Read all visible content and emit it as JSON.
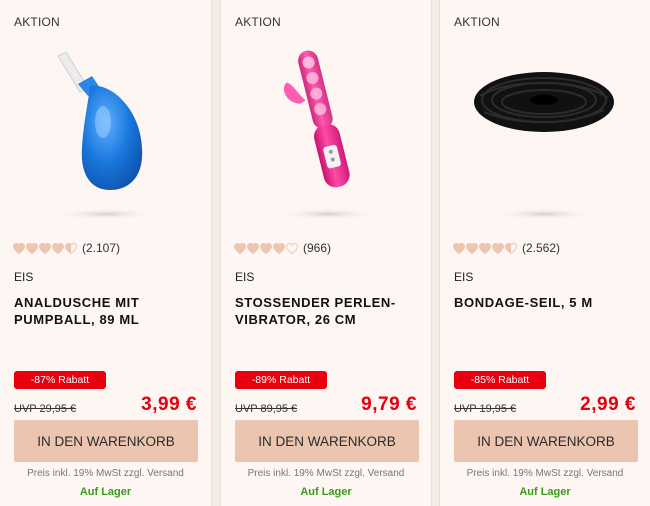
{
  "colors": {
    "accent_red": "#e3000f",
    "discount_bg": "#e8000e",
    "cart_bg": "#ebc5b0",
    "stock_green": "#3b9a1a",
    "heart_fill": "#ecc6b1"
  },
  "products": [
    {
      "badge": "AKTION",
      "image_icon": "enema-bulb-image",
      "rating": {
        "hearts_filled": 4.5,
        "hearts_total": 5,
        "count": "(2.107)"
      },
      "brand": "EIS",
      "title": "ANALDUSCHE MIT PUMPBALL, 89 ML",
      "discount": "-87% Rabatt",
      "uvp": "UVP 29,95 €",
      "price": "3,99 €",
      "cart_label": "IN DEN WARENKORB",
      "price_note": "Preis inkl. 19% MwSt zzgl. Versand",
      "stock": "Auf Lager"
    },
    {
      "badge": "AKTION",
      "image_icon": "pink-vibrator-image",
      "rating": {
        "hearts_filled": 4,
        "hearts_total": 5,
        "count": "(966)"
      },
      "brand": "EIS",
      "title": "STOSSENDER PERLEN-VIBRATOR, 26 CM",
      "discount": "-89% Rabatt",
      "uvp": "UVP 89,95 €",
      "price": "9,79 €",
      "cart_label": "IN DEN WARENKORB",
      "price_note": "Preis inkl. 19% MwSt zzgl. Versand",
      "stock": "Auf Lager"
    },
    {
      "badge": "AKTION",
      "image_icon": "black-rope-image",
      "rating": {
        "hearts_filled": 4.5,
        "hearts_total": 5,
        "count": "(2.562)"
      },
      "brand": "EIS",
      "title": "BONDAGE-SEIL, 5 M",
      "discount": "-85% Rabatt",
      "uvp": "UVP 19,95 €",
      "price": "2,99 €",
      "cart_label": "IN DEN WARENKORB",
      "price_note": "Preis inkl. 19% MwSt zzgl. Versand",
      "stock": "Auf Lager"
    }
  ]
}
